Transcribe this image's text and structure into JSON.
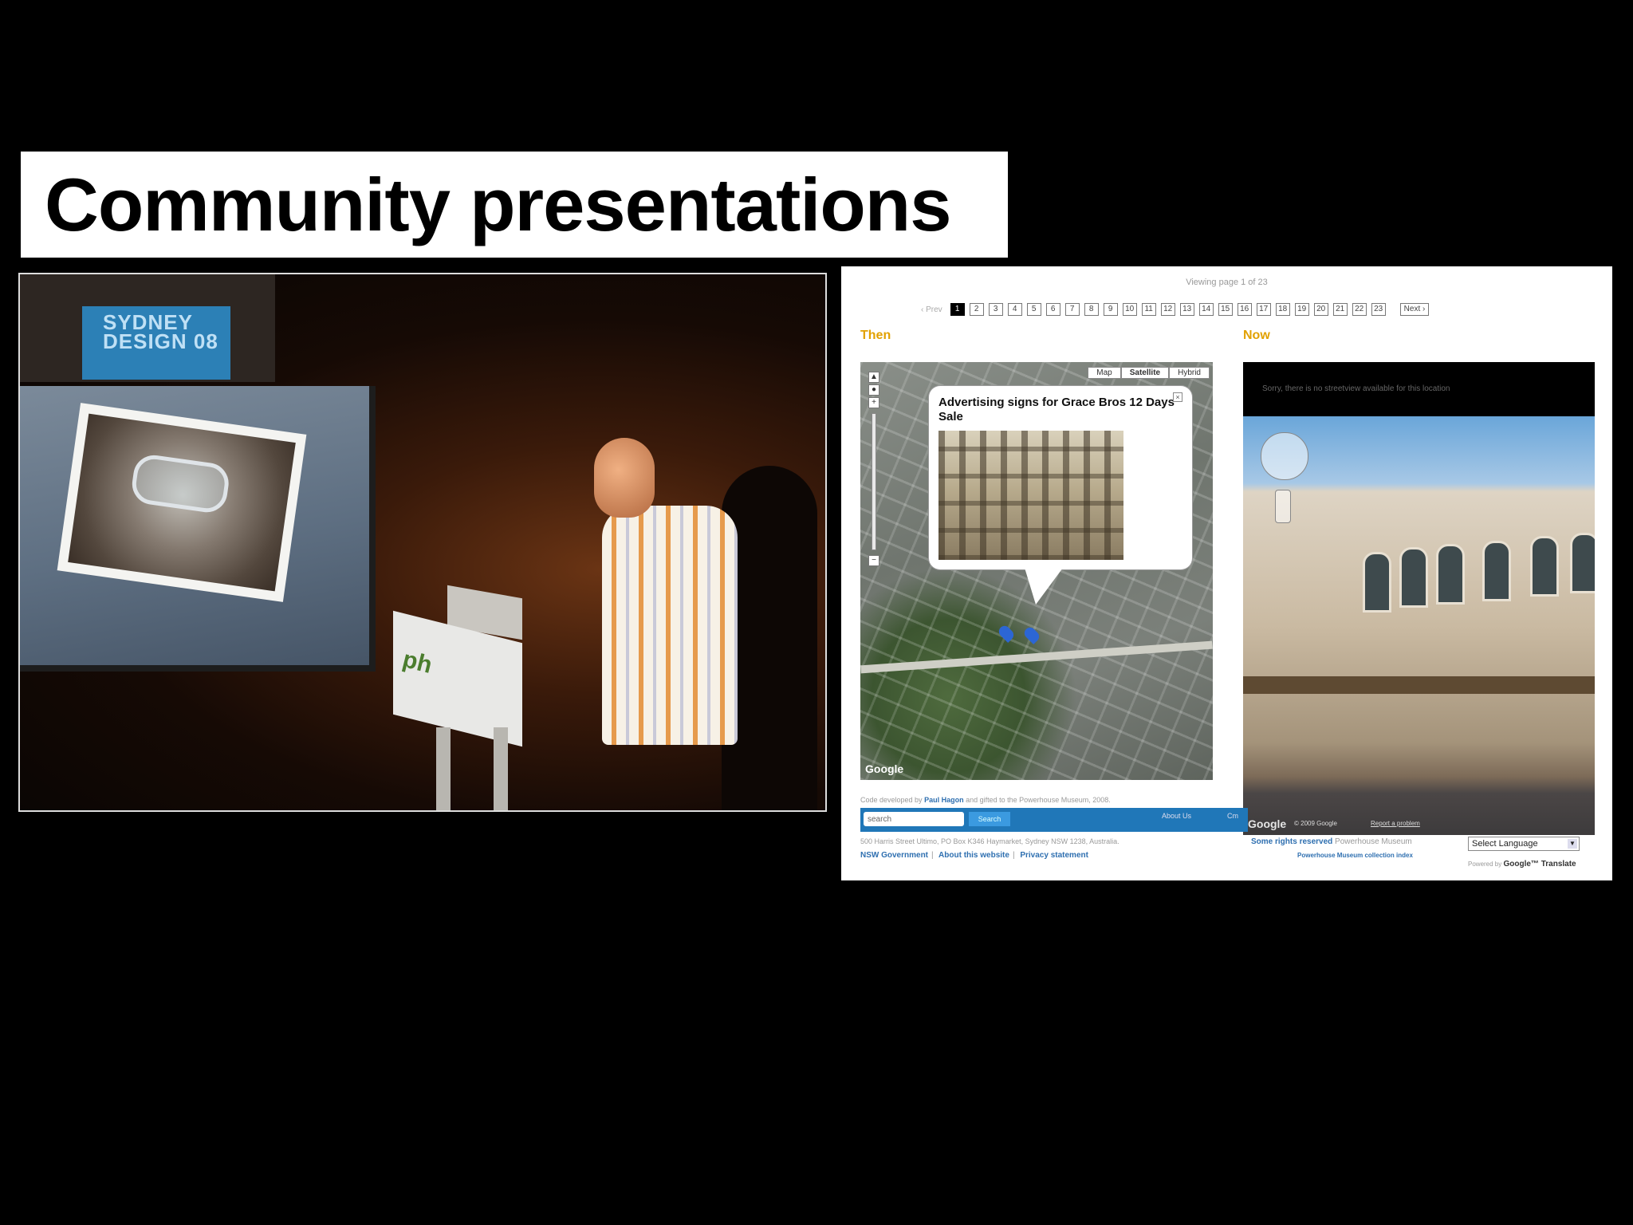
{
  "slide": {
    "title": "Community presentations"
  },
  "photo": {
    "banner_text": "SYDNEY DESIGN 08",
    "podium_text": "ph"
  },
  "website": {
    "viewing_text": "Viewing page 1 of 23",
    "pager": {
      "prev_label": "‹ Prev",
      "pages": [
        "1",
        "2",
        "3",
        "4",
        "5",
        "6",
        "7",
        "8",
        "9",
        "10",
        "11",
        "12",
        "13",
        "14",
        "15",
        "16",
        "17",
        "18",
        "19",
        "20",
        "21",
        "22",
        "23"
      ],
      "active_page": "1",
      "next_label": "Next ›"
    },
    "then_label": "Then",
    "now_label": "Now",
    "map": {
      "types": [
        "Map",
        "Satellite",
        "Hybrid"
      ],
      "selected_type": "Satellite",
      "popup_title": "Advertising signs for Grace Bros 12 Days Sale",
      "google_logo": "Google"
    },
    "streetview": {
      "notice": "Sorry, there is no streetview available for this location",
      "google_logo": "Google",
      "copyright": "© 2009 Google",
      "report_link": "Report a problem"
    },
    "credit_prefix": "Code developed by",
    "credit_name": "Paul Hagon",
    "credit_suffix": "and gifted to the Powerhouse Museum, 2008.",
    "search_placeholder": "search",
    "search_button": "Search",
    "about_link": "About Us",
    "cut_link": "Cm",
    "address": "500 Harris Street Ultimo, PO Box K346 Haymarket, Sydney NSW 1238, Australia.",
    "footer_links": [
      "NSW Government",
      "About this website",
      "Privacy statement"
    ],
    "rights_bold": "Some rights reserved",
    "rights_rest": "Powerhouse Museum",
    "collection_link": "Powerhouse Museum collection index",
    "language_select": "Select Language",
    "powered_by": "Powered by",
    "translate_brand": "Google™ Translate"
  }
}
